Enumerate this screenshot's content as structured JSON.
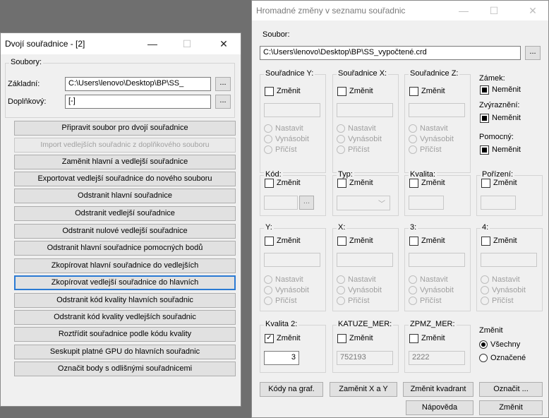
{
  "left": {
    "title": "Dvojí souřadnice - [2]",
    "controls": {
      "minimize": "—",
      "maximize": "☐",
      "close": "✕"
    },
    "files_group": "Soubory:",
    "base_label": "Základní:",
    "base_value": "C:\\Users\\lenovo\\Desktop\\BP\\SS_",
    "aux_label": "Doplňkový:",
    "aux_value": "[-]",
    "browse": "...",
    "buttons": [
      "Připravit soubor pro dvojí souřadnice",
      "Import vedlejších souřadnic z doplňkového souboru",
      "Zaměnit hlavní a vedlejší souřadnice",
      "Exportovat vedlejší souřadnice do nového souboru",
      "Odstranit hlavní souřadnice",
      "Odstranit vedlejší souřadnice",
      "Odstranit nulové vedlejší souřadnice",
      "Odstranit hlavní souřadnice pomocných bodů",
      "Zkopírovat hlavní souřadnice do vedlejších",
      "Zkopírovat vedlejší souřadnice do hlavních",
      "Odstranit kód kvality hlavních souřadnic",
      "Odstranit kód kvality vedlejších souřadnic",
      "Roztřídit souřadnice podle kódu kvality",
      "Seskupit platné GPU do hlavních souřadnic",
      "Označit body s odlišnými souřadnicemi"
    ]
  },
  "right": {
    "title": "Hromadné změny v seznamu souřadnic",
    "controls": {
      "minimize": "—",
      "maximize": "☐",
      "close": "✕"
    },
    "file_label": "Soubor:",
    "file_value": "C:\\Users\\lenovo\\Desktop\\BP\\SS_vypočtené.crd",
    "browse": "...",
    "change": "Změnit",
    "keep": "Neměnit",
    "opt_set": "Nastavit",
    "opt_mul": "Vynásobit",
    "opt_add": "Přičíst",
    "groups": {
      "y": "Souřadnice Y:",
      "x": "Souřadnice X:",
      "z": "Souřadnice Z:",
      "lock": "Zámek:",
      "highlight": "Zvýraznění:",
      "aux": "Pomocný:",
      "code": "Kód:",
      "type": "Typ:",
      "quality": "Kvalita:",
      "acq": "Pořízení:",
      "c1": "Y:",
      "c2": "X:",
      "c3": "3:",
      "c4": "4:",
      "q2": "Kvalita 2:",
      "katuze": "KATUZE_MER:",
      "zpmz": "ZPMZ_MER:",
      "scope": "Změnit"
    },
    "q2_value": "3",
    "katuze_value": "752193",
    "zpmz_value": "2222",
    "scope_all": "Všechny",
    "scope_marked": "Označené",
    "btn_codes": "Kódy na graf.",
    "btn_swap": "Zaměnit X a Y",
    "btn_quadrant": "Změnit kvadrant",
    "btn_mark": "Označit ...",
    "btn_help": "Nápověda",
    "btn_apply": "Změnit"
  }
}
